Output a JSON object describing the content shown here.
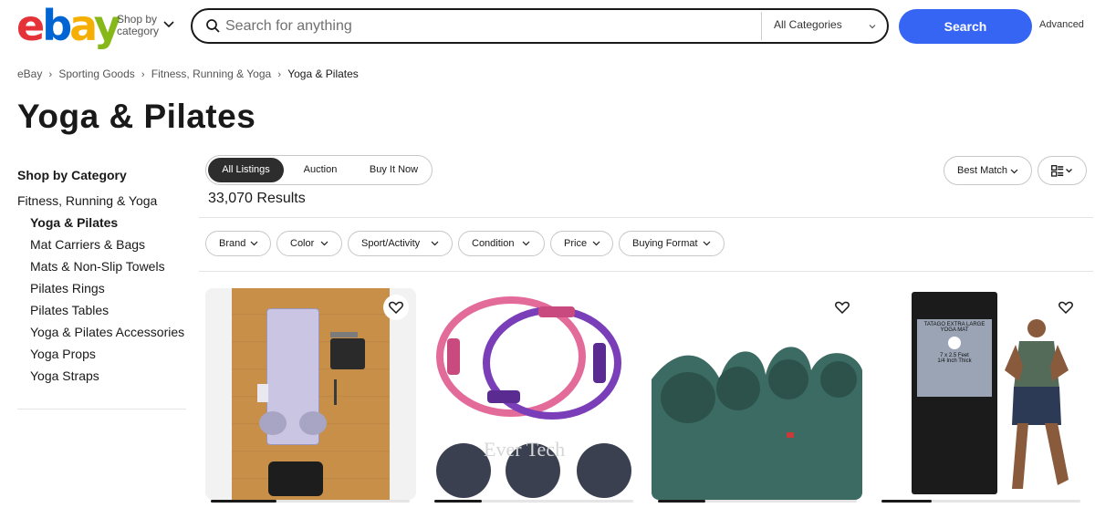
{
  "header": {
    "logo_letters": [
      "e",
      "b",
      "a",
      "y"
    ],
    "shop_by_line1": "Shop by",
    "shop_by_line2": "category",
    "search_placeholder": "Search for anything",
    "category_select": "All Categories",
    "search_button": "Search",
    "advanced_link": "Advanced"
  },
  "breadcrumb": [
    "eBay",
    "Sporting Goods",
    "Fitness, Running & Yoga",
    "Yoga & Pilates"
  ],
  "page_title": "Yoga & Pilates",
  "sidebar": {
    "heading": "Shop by Category",
    "parent": "Fitness, Running & Yoga",
    "items": [
      {
        "label": "Yoga & Pilates",
        "selected": true
      },
      {
        "label": "Mat Carriers & Bags",
        "selected": false
      },
      {
        "label": "Mats & Non-Slip Towels",
        "selected": false
      },
      {
        "label": "Pilates Rings",
        "selected": false
      },
      {
        "label": "Pilates Tables",
        "selected": false
      },
      {
        "label": "Yoga & Pilates Accessories",
        "selected": false
      },
      {
        "label": "Yoga Props",
        "selected": false
      },
      {
        "label": "Yoga Straps",
        "selected": false
      }
    ]
  },
  "tabs": [
    {
      "label": "All Listings",
      "active": true
    },
    {
      "label": "Auction",
      "active": false
    },
    {
      "label": "Buy It Now",
      "active": false
    }
  ],
  "sort_label": "Best Match",
  "results_count": "33,070 Results",
  "filters": [
    "Brand",
    "Color",
    "Sport/Activity",
    "Condition",
    "Price",
    "Buying Format"
  ],
  "cards": [
    {
      "image": "pilates-reformer-board",
      "has_heart": true,
      "progress": 0.33
    },
    {
      "image": "pilates-rings",
      "has_heart": false,
      "progress": 0.24,
      "watermark": "Ever Tech"
    },
    {
      "image": "green-yoga-mat",
      "has_heart": true,
      "progress": 0.24
    },
    {
      "image": "black-yoga-mat",
      "has_heart": true,
      "progress": 0.25,
      "mat_text": [
        "TATAGO EXTRA LARGE",
        "YOGA MAT",
        "7 x 2.5 Feet",
        "1/4 Inch Thick"
      ]
    }
  ],
  "colors": {
    "accent": "#3665f3",
    "text": "#191919",
    "card_bg": "#f2f2f2",
    "logo_e": "#e53238",
    "logo_b": "#0064d2",
    "logo_a": "#f5af02",
    "logo_y": "#86b817"
  }
}
